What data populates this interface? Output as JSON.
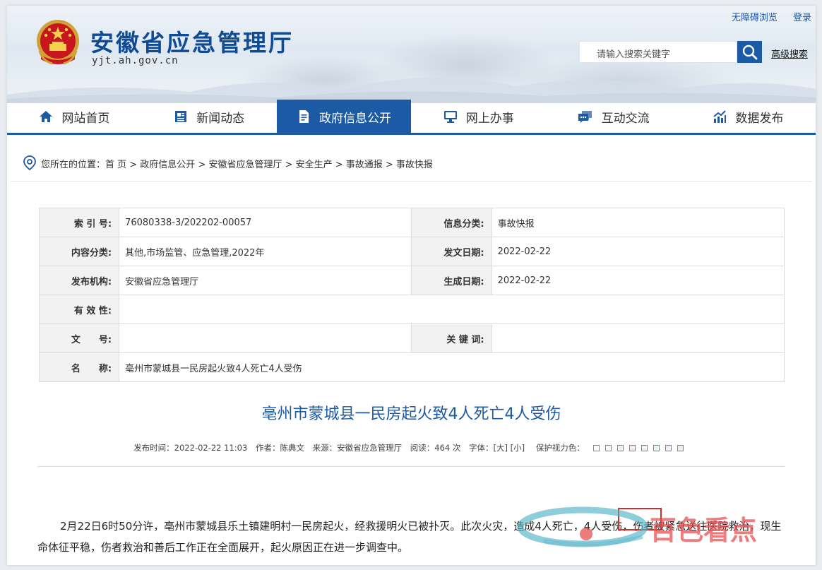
{
  "header": {
    "site_title": "安徽省应急管理厅",
    "site_url": "yjt.ah.gov.cn",
    "top_links": [
      "无障碍浏览",
      "登录"
    ],
    "search_placeholder": "请输入搜索关键字",
    "advanced_search": "高级搜索"
  },
  "nav": {
    "items": [
      {
        "label": "网站首页",
        "icon": "home-icon"
      },
      {
        "label": "新闻动态",
        "icon": "news-icon"
      },
      {
        "label": "政府信息公开",
        "icon": "document-icon",
        "active": true
      },
      {
        "label": "网上办事",
        "icon": "monitor-icon"
      },
      {
        "label": "互动交流",
        "icon": "chat-icon"
      },
      {
        "label": "数据发布",
        "icon": "chart-icon"
      }
    ]
  },
  "breadcrumb": {
    "prefix": "您所在的位置：",
    "path": "首 页 > 政府信息公开 > 安徽省应急管理厅 > 安全生产 > 事故通报 > 事故快报"
  },
  "info_table": {
    "index_label": "索 引 号:",
    "index_value": "76080338-3/202202-00057",
    "category_label": "信息分类:",
    "category_value": "事故快报",
    "content_label": "内容分类:",
    "content_value": "其他,市场监管、应急管理,2022年",
    "issue_date_label": "发文日期:",
    "issue_date_value": "2022-02-22",
    "publisher_label": "发布机构:",
    "publisher_value": "安徽省应急管理厅",
    "created_label": "生成日期:",
    "created_value": "2022-02-22",
    "validity_label": "有 效 性:",
    "validity_value": "",
    "docno_label": "文　　号:",
    "docno_value": "",
    "keywords_label": "关 键 词:",
    "keywords_value": "",
    "name_label": "名　　称:",
    "name_value": "亳州市蒙城县一民房起火致4人死亡4人受伤"
  },
  "article": {
    "title": "亳州市蒙城县一民房起火致4人死亡4人受伤",
    "meta_time": "发布时间：2022-02-22 11:03",
    "meta_author": "作者：陈典文",
    "meta_source": "来源：安徽省应急管理厅",
    "meta_views": "阅读：464 次",
    "meta_font": "字体：[大] [小]",
    "meta_eye": "保护视力色：",
    "swatch_colors": [
      "#ffffff",
      "#fafaf0",
      "#f4f0e6",
      "#fbe9ea",
      "#eef6ee",
      "#e8f4f4",
      "#eef0fb",
      "#eeeeee"
    ],
    "body": "2月22日6时50分许，亳州市蒙城县乐土镇建明村一民房起火，经救援明火已被扑灭。此次火灾，造成4人死亡，4人受伤，伤者被紧急送往医院救治，现生命体征平稳，伤者救治和善后工作正在全面展开，起火原因正在进一步调查中。"
  },
  "watermark": {
    "text": "百色看点"
  },
  "colors": {
    "brand_blue": "#1c5aa6",
    "highlight_red": "#d42b2b"
  }
}
